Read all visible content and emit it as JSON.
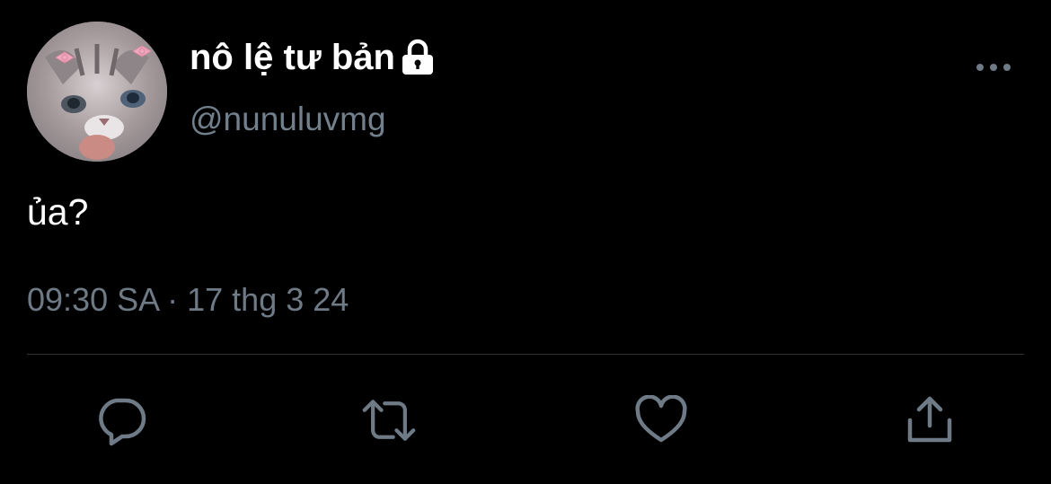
{
  "user": {
    "display_name": "nô lệ tư bản",
    "handle": "@nunuluvmg",
    "avatar_icon": "kitten-avatar",
    "protected_icon": "lock-icon"
  },
  "tweet": {
    "text": "ủa?",
    "timestamp": "09:30 SA · 17 thg 3 24"
  },
  "actions": {
    "reply_icon": "reply-icon",
    "retweet_icon": "retweet-icon",
    "like_icon": "heart-icon",
    "share_icon": "share-icon"
  },
  "colors": {
    "background": "#000000",
    "text_primary": "#ffffff",
    "text_secondary": "#71808c",
    "icon": "#6e7a86",
    "divider": "#2f3336"
  }
}
